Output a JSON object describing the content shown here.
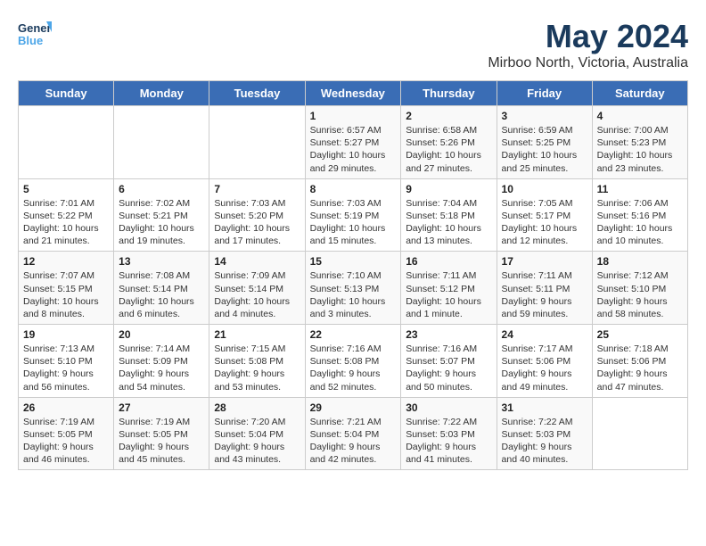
{
  "logo": {
    "line1": "General",
    "line2": "Blue"
  },
  "title": "May 2024",
  "subtitle": "Mirboo North, Victoria, Australia",
  "days_of_week": [
    "Sunday",
    "Monday",
    "Tuesday",
    "Wednesday",
    "Thursday",
    "Friday",
    "Saturday"
  ],
  "weeks": [
    [
      {
        "day": "",
        "info": ""
      },
      {
        "day": "",
        "info": ""
      },
      {
        "day": "",
        "info": ""
      },
      {
        "day": "1",
        "info": "Sunrise: 6:57 AM\nSunset: 5:27 PM\nDaylight: 10 hours\nand 29 minutes."
      },
      {
        "day": "2",
        "info": "Sunrise: 6:58 AM\nSunset: 5:26 PM\nDaylight: 10 hours\nand 27 minutes."
      },
      {
        "day": "3",
        "info": "Sunrise: 6:59 AM\nSunset: 5:25 PM\nDaylight: 10 hours\nand 25 minutes."
      },
      {
        "day": "4",
        "info": "Sunrise: 7:00 AM\nSunset: 5:23 PM\nDaylight: 10 hours\nand 23 minutes."
      }
    ],
    [
      {
        "day": "5",
        "info": "Sunrise: 7:01 AM\nSunset: 5:22 PM\nDaylight: 10 hours\nand 21 minutes."
      },
      {
        "day": "6",
        "info": "Sunrise: 7:02 AM\nSunset: 5:21 PM\nDaylight: 10 hours\nand 19 minutes."
      },
      {
        "day": "7",
        "info": "Sunrise: 7:03 AM\nSunset: 5:20 PM\nDaylight: 10 hours\nand 17 minutes."
      },
      {
        "day": "8",
        "info": "Sunrise: 7:03 AM\nSunset: 5:19 PM\nDaylight: 10 hours\nand 15 minutes."
      },
      {
        "day": "9",
        "info": "Sunrise: 7:04 AM\nSunset: 5:18 PM\nDaylight: 10 hours\nand 13 minutes."
      },
      {
        "day": "10",
        "info": "Sunrise: 7:05 AM\nSunset: 5:17 PM\nDaylight: 10 hours\nand 12 minutes."
      },
      {
        "day": "11",
        "info": "Sunrise: 7:06 AM\nSunset: 5:16 PM\nDaylight: 10 hours\nand 10 minutes."
      }
    ],
    [
      {
        "day": "12",
        "info": "Sunrise: 7:07 AM\nSunset: 5:15 PM\nDaylight: 10 hours\nand 8 minutes."
      },
      {
        "day": "13",
        "info": "Sunrise: 7:08 AM\nSunset: 5:14 PM\nDaylight: 10 hours\nand 6 minutes."
      },
      {
        "day": "14",
        "info": "Sunrise: 7:09 AM\nSunset: 5:14 PM\nDaylight: 10 hours\nand 4 minutes."
      },
      {
        "day": "15",
        "info": "Sunrise: 7:10 AM\nSunset: 5:13 PM\nDaylight: 10 hours\nand 3 minutes."
      },
      {
        "day": "16",
        "info": "Sunrise: 7:11 AM\nSunset: 5:12 PM\nDaylight: 10 hours\nand 1 minute."
      },
      {
        "day": "17",
        "info": "Sunrise: 7:11 AM\nSunset: 5:11 PM\nDaylight: 9 hours\nand 59 minutes."
      },
      {
        "day": "18",
        "info": "Sunrise: 7:12 AM\nSunset: 5:10 PM\nDaylight: 9 hours\nand 58 minutes."
      }
    ],
    [
      {
        "day": "19",
        "info": "Sunrise: 7:13 AM\nSunset: 5:10 PM\nDaylight: 9 hours\nand 56 minutes."
      },
      {
        "day": "20",
        "info": "Sunrise: 7:14 AM\nSunset: 5:09 PM\nDaylight: 9 hours\nand 54 minutes."
      },
      {
        "day": "21",
        "info": "Sunrise: 7:15 AM\nSunset: 5:08 PM\nDaylight: 9 hours\nand 53 minutes."
      },
      {
        "day": "22",
        "info": "Sunrise: 7:16 AM\nSunset: 5:08 PM\nDaylight: 9 hours\nand 52 minutes."
      },
      {
        "day": "23",
        "info": "Sunrise: 7:16 AM\nSunset: 5:07 PM\nDaylight: 9 hours\nand 50 minutes."
      },
      {
        "day": "24",
        "info": "Sunrise: 7:17 AM\nSunset: 5:06 PM\nDaylight: 9 hours\nand 49 minutes."
      },
      {
        "day": "25",
        "info": "Sunrise: 7:18 AM\nSunset: 5:06 PM\nDaylight: 9 hours\nand 47 minutes."
      }
    ],
    [
      {
        "day": "26",
        "info": "Sunrise: 7:19 AM\nSunset: 5:05 PM\nDaylight: 9 hours\nand 46 minutes."
      },
      {
        "day": "27",
        "info": "Sunrise: 7:19 AM\nSunset: 5:05 PM\nDaylight: 9 hours\nand 45 minutes."
      },
      {
        "day": "28",
        "info": "Sunrise: 7:20 AM\nSunset: 5:04 PM\nDaylight: 9 hours\nand 43 minutes."
      },
      {
        "day": "29",
        "info": "Sunrise: 7:21 AM\nSunset: 5:04 PM\nDaylight: 9 hours\nand 42 minutes."
      },
      {
        "day": "30",
        "info": "Sunrise: 7:22 AM\nSunset: 5:03 PM\nDaylight: 9 hours\nand 41 minutes."
      },
      {
        "day": "31",
        "info": "Sunrise: 7:22 AM\nSunset: 5:03 PM\nDaylight: 9 hours\nand 40 minutes."
      },
      {
        "day": "",
        "info": ""
      }
    ]
  ]
}
